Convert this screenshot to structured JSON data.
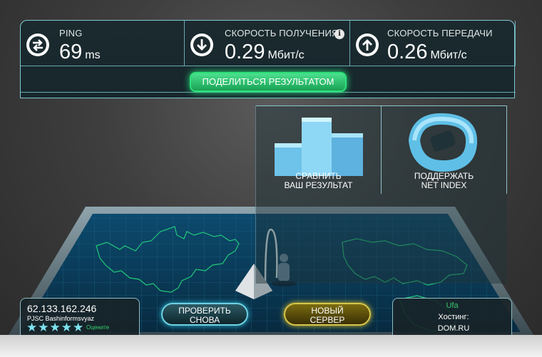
{
  "stats": [
    {
      "id": "ping",
      "label": "PING",
      "value": "69",
      "unit": "ms",
      "icon": "ping-arrows-icon"
    },
    {
      "id": "download",
      "label": "СКОРОСТЬ ПОЛУЧЕНИЯ",
      "value": "0.29",
      "unit": "Мбит/с",
      "icon": "download-arrow-icon"
    },
    {
      "id": "upload",
      "label": "СКОРОСТЬ ПЕРЕДАЧИ",
      "value": "0.26",
      "unit": "Мбит/с",
      "icon": "upload-arrow-icon"
    }
  ],
  "info_icon": "i",
  "share_button": "ПОДЕЛИТЬСЯ РЕЗУЛЬТАТОМ",
  "compare": {
    "line1": "СРАВНИТЬ",
    "line2": "ВАШ РЕЗУЛЬТАТ"
  },
  "support": {
    "line1": "ПОДДЕРЖАТЬ",
    "line2": "NET INDEX"
  },
  "client": {
    "ip": "62.133.162.246",
    "isp": "PJSC Bashinformsvyaz",
    "rate_label": "Оцените",
    "stars": 5
  },
  "buttons": {
    "retest_line1": "ПРОВЕРИТЬ",
    "retest_line2": "СНОВА",
    "newserver_line1": "НОВЫЙ",
    "newserver_line2": "СЕРВЕР"
  },
  "server": {
    "city": "Ufa",
    "host_label": "Хостинг:",
    "host_name": "DOM.RU"
  },
  "colors": {
    "accent_green": "#2ee07a",
    "accent_cyan": "#6fd2e4",
    "accent_gold": "#d7c64a",
    "map_line": "#22c97a"
  }
}
